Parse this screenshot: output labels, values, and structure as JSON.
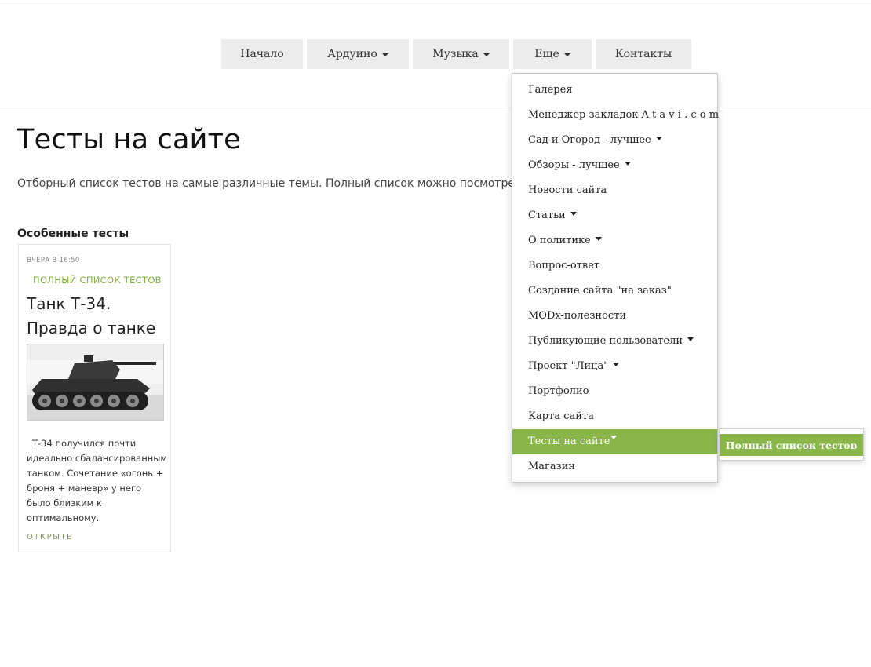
{
  "nav": {
    "items": [
      {
        "label": "Начало",
        "has_caret": false
      },
      {
        "label": "Ардуино",
        "has_caret": true
      },
      {
        "label": "Музыка",
        "has_caret": true
      },
      {
        "label": "Еще",
        "has_caret": true
      },
      {
        "label": "Контакты",
        "has_caret": false
      }
    ]
  },
  "dropdown": {
    "items": [
      {
        "label": "Галерея",
        "has_caret": false
      },
      {
        "label": "Менеджер закладок A t a v i . c o m",
        "has_caret": false
      },
      {
        "label": "Сад и Огород - лучшее",
        "has_caret": true
      },
      {
        "label": "Обзоры - лучшее",
        "has_caret": true
      },
      {
        "label": "Новости сайта",
        "has_caret": false
      },
      {
        "label": "Статьи",
        "has_caret": true
      },
      {
        "label": "О политике",
        "has_caret": true
      },
      {
        "label": "Вопрос-ответ",
        "has_caret": false
      },
      {
        "label": "Создание сайта \"на заказ\"",
        "has_caret": false
      },
      {
        "label": "MODx-полезности",
        "has_caret": false
      },
      {
        "label": "Публикующие пользователи",
        "has_caret": true
      },
      {
        "label": "Проект \"Лица\"",
        "has_caret": true
      },
      {
        "label": "Портфолио",
        "has_caret": false
      },
      {
        "label": "Карта сайта",
        "has_caret": false
      },
      {
        "label": "Тесты на сайте",
        "has_caret": true,
        "active": true
      },
      {
        "label": "Магазин",
        "has_caret": false
      }
    ],
    "submenu": {
      "label": "Полный список тестов"
    }
  },
  "main": {
    "title": "Тесты на сайте",
    "intro": "Отборный список тестов на самые различные темы. Полный список можно посмотре",
    "section_title": "Особенные тесты"
  },
  "card": {
    "date": "ВЧЕРА В 16:50",
    "category": "ПОЛНЫЙ СПИСОК ТЕСТОВ",
    "title": "Танк Т-34. Правда о танке",
    "text": "Т-34 получился почти идеально сбалансированным танком. Сочетание «огонь + броня + маневр» у него было близким к оптимальному.",
    "open_label": "ОТКРЫТЬ",
    "image_icon": "tank-photo"
  },
  "colors": {
    "accent": "#8ab54b",
    "nav_bg": "#ececec",
    "category_green": "#7faf3c"
  }
}
